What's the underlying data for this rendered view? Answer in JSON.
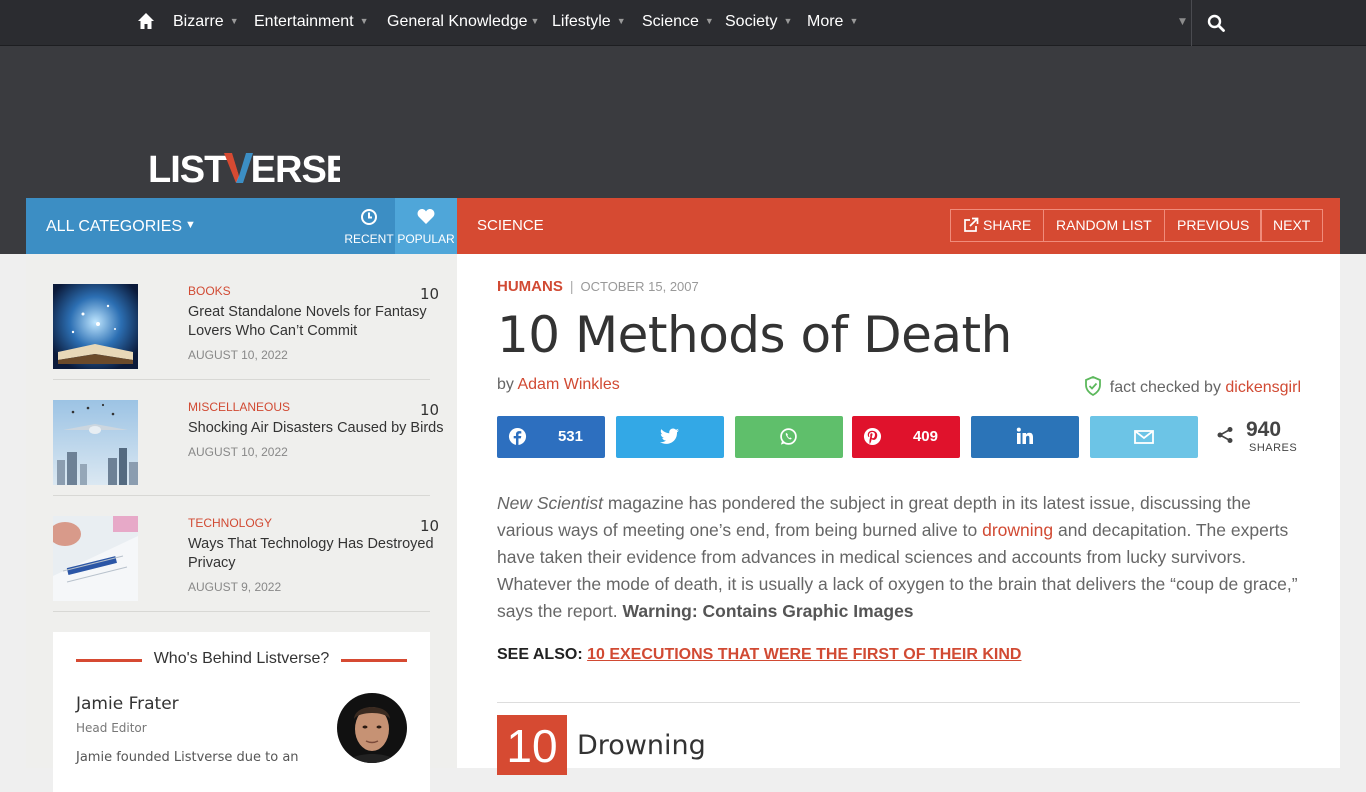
{
  "nav": {
    "items": [
      {
        "label": "Bizarre"
      },
      {
        "label": "Entertainment"
      },
      {
        "label": "General Knowledge"
      },
      {
        "label": "Lifestyle"
      },
      {
        "label": "Science"
      },
      {
        "label": "Society"
      },
      {
        "label": "More"
      }
    ],
    "caret": "▼"
  },
  "logo": {
    "text": "LISTVERSE"
  },
  "categories": {
    "all_label": "ALL CATEGORIES",
    "recent_label": "RECENT",
    "popular_label": "POPULAR"
  },
  "section": {
    "label": "SCIENCE",
    "share_label": "SHARE",
    "random_label": "RANDOM LIST",
    "previous_label": "PREVIOUS",
    "next_label": "NEXT"
  },
  "sidebar": {
    "items": [
      {
        "category": "BOOKS",
        "count": "10",
        "title": "Great Standalone Novels for Fantasy Lovers Who Can’t Commit",
        "date": "AUGUST 10, 2022"
      },
      {
        "category": "MISCELLANEOUS",
        "count": "10",
        "title": "Shocking Air Disasters Caused by Birds",
        "date": "AUGUST 10, 2022"
      },
      {
        "category": "TECHNOLOGY",
        "count": "10",
        "title": "Ways That Technology Has Destroyed Privacy",
        "date": "AUGUST 9, 2022"
      }
    ],
    "who": {
      "title": "Who's Behind Listverse?",
      "name": "Jamie Frater",
      "role": "Head Editor",
      "desc": "Jamie founded Listverse due to an"
    }
  },
  "article": {
    "topic": "HUMANS",
    "pipe": "|",
    "date": "OCTOBER 15, 2007",
    "title": "10 Methods of Death",
    "by_prefix": "by ",
    "author": "Adam Winkles",
    "fact_prefix": "fact checked by ",
    "fact_checker": "dickensgirl",
    "shares": {
      "facebook": "531",
      "pinterest": "409",
      "total": "940",
      "total_label": "SHARES"
    },
    "body": {
      "em": "New Scientist",
      "p1": " magazine has pondered the subject in great depth in its latest issue, discussing the various ways of meeting one’s end, from being burned alive to ",
      "link": "drowning",
      "p2": " and decapitation. The experts have taken their evidence from advances in medical sciences and accounts from lucky survivors. Whatever the mode of death, it is usually a lack of oxygen to the brain that delivers the “coup de grace,” says the report. ",
      "warning": "Warning: Contains Graphic Images"
    },
    "see_also_label": "SEE ALSO: ",
    "see_also_link": "10 EXECUTIONS THAT WERE THE FIRST OF THEIR KIND",
    "item_number": "10",
    "item_title": "Drowning"
  },
  "colors": {
    "accent": "#d64a32",
    "category_blue": "#3c8ec4",
    "facebook": "#2d6fbf",
    "twitter": "#33a8e6",
    "whatsapp": "#5fbf6b",
    "pinterest": "#e0122c",
    "linkedin": "#2b74b8",
    "email": "#6cc4e6"
  }
}
